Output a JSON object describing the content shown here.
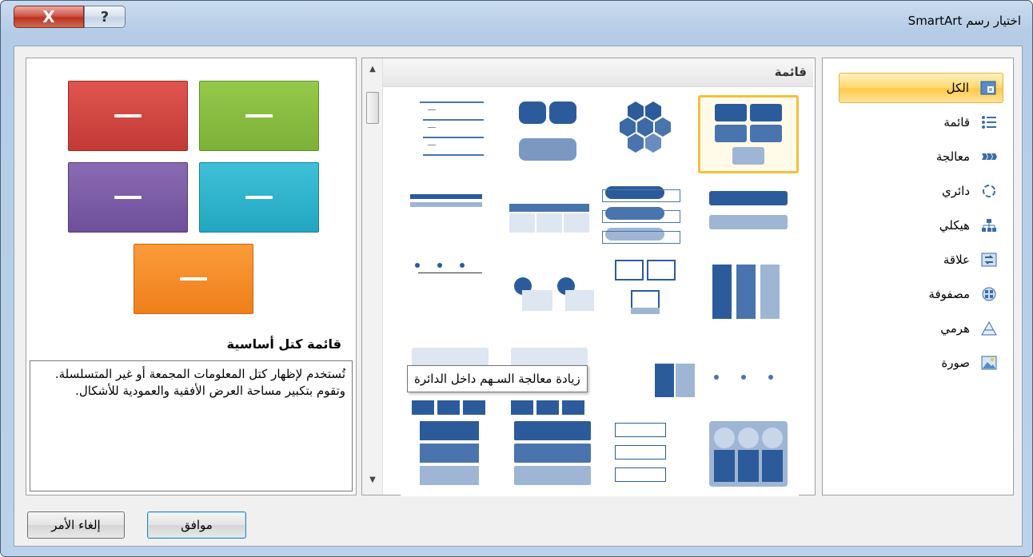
{
  "window": {
    "title": "اختيار رسم SmartArt",
    "close_glyph": "X",
    "help_glyph": "?"
  },
  "categories": [
    {
      "label": "الكل",
      "icon": "all-icon",
      "selected": true
    },
    {
      "label": "قائمة",
      "icon": "list-icon"
    },
    {
      "label": "معالجة",
      "icon": "process-icon"
    },
    {
      "label": "دائري",
      "icon": "cycle-icon"
    },
    {
      "label": "هيكلي",
      "icon": "hierarchy-icon"
    },
    {
      "label": "علاقة",
      "icon": "relationship-icon"
    },
    {
      "label": "مصفوفة",
      "icon": "matrix-icon"
    },
    {
      "label": "هرمي",
      "icon": "pyramid-icon"
    },
    {
      "label": "صورة",
      "icon": "picture-icon"
    }
  ],
  "gallery": {
    "header": "قائمة",
    "tooltip": "زيادة معالجة السـهم داخل الدائرة"
  },
  "preview": {
    "layout_title": "قائمة كتل أساسية",
    "description": "تُستخدم لإظهار كتل المعلومات المجمعة أو غير المتسلسلة. وتقوم بتكبير مساحة العرض الأفقية والعمودية للأشكال."
  },
  "buttons": {
    "ok": "موافق",
    "cancel": "إلغاء الأمر"
  },
  "colors": {
    "accent_blue": "#4a74ad",
    "selection_gold": "#ffd86e"
  }
}
